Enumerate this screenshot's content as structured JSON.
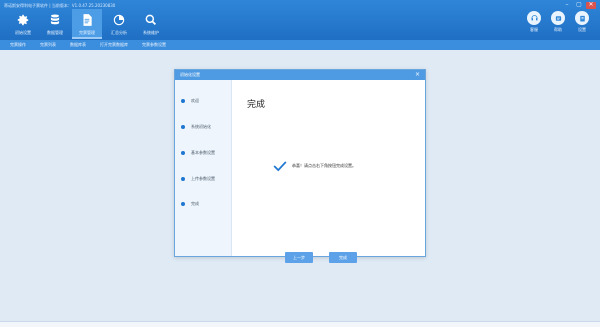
{
  "app": {
    "title": "蒂诺斯安得利电子票软件  |  当前版本：V1.0.47.25.20230830",
    "colors": {
      "header": "#2f86d8",
      "subnav": "#3b8ddd",
      "accent": "#1f77d0",
      "background": "#dfeaf5"
    }
  },
  "window_controls": {
    "minimize": "–",
    "maximize": "▢",
    "close": "✕"
  },
  "main_nav": [
    {
      "label": "初始设置",
      "icon": "gear-icon"
    },
    {
      "label": "数据管理",
      "icon": "database-icon"
    },
    {
      "label": "完票管理",
      "icon": "document-icon",
      "active": true
    },
    {
      "label": "汇总分析",
      "icon": "chart-icon"
    },
    {
      "label": "系统维护",
      "icon": "settings-search-icon"
    }
  ],
  "right_tools": [
    {
      "label": "客服",
      "icon": "headset-icon"
    },
    {
      "label": "帮助",
      "icon": "help-icon"
    },
    {
      "label": "设置",
      "icon": "settings-icon"
    }
  ],
  "subnav": [
    "完票操作",
    "完票列表",
    "数据库表",
    "打开完票数据库",
    "完票参数设置"
  ],
  "dialog": {
    "title": "初始化设置",
    "steps": [
      "欢迎",
      "系统初始化",
      "基本参数设置",
      "上传参数设置",
      "完成"
    ],
    "content_title": "完成",
    "success_message": "恭喜！请点击右下角按钮完成设置。",
    "buttons": {
      "back": "上一步",
      "finish": "完成"
    }
  }
}
